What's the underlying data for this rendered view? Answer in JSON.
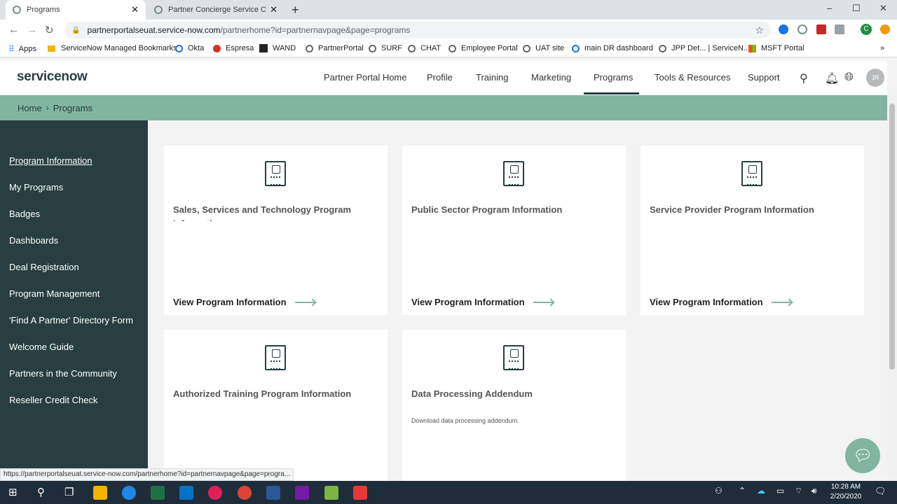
{
  "browser": {
    "tabs": [
      {
        "title": "Programs",
        "active": true
      },
      {
        "title": "Partner Concierge Service Center",
        "active": false
      }
    ],
    "new_tab_icon": "plus-icon",
    "window_controls": {
      "minimize": "–",
      "maximize": "☐",
      "close": "✕"
    },
    "url": "partnerportalseuat.service-now.com/partnerhome?id=partnernavpage&page=programs",
    "url_host": "partnerportalseuat.service-now.com",
    "url_path": "/partnerhome?id=partnernavpage&page=programs",
    "bookmarks": [
      "Apps",
      "ServiceNow Managed Bookmarks",
      "Okta",
      "Espresa",
      "WAND",
      "PartnerPortal",
      "SURF",
      "CHAT",
      "Employee Portal",
      "UAT site",
      "main DR dashboard",
      "JPP Det... | ServiceN...",
      "MSFT Portal"
    ],
    "bookmark_overflow": "»",
    "profile_initial": "C",
    "status_url": "https://partnerportalseuat.service-now.com/partnerhome?id=partnernavpage&page=progra..."
  },
  "header": {
    "logo": "servicenow",
    "nav": [
      "Partner Portal Home",
      "Profile",
      "Training",
      "Marketing",
      "Programs",
      "Tools & Resources",
      "Support"
    ],
    "active_nav": "Programs",
    "avatar_initials": "JR"
  },
  "breadcrumb": {
    "home": "Home",
    "separator": "›",
    "current": "Programs"
  },
  "sidebar": {
    "items": [
      {
        "label": "Program Information",
        "active": true
      },
      {
        "label": "My Programs"
      },
      {
        "label": "Badges"
      },
      {
        "label": "Dashboards"
      },
      {
        "label": "Deal Registration"
      },
      {
        "label": "Program Management"
      },
      {
        "label": "'Find A Partner' Directory Form"
      },
      {
        "label": "Welcome Guide"
      },
      {
        "label": "Partners in the Community"
      },
      {
        "label": "Reseller Credit Check"
      }
    ]
  },
  "cards": [
    {
      "title": "Sales, Services and Technology Program Information",
      "link": "View Program Information",
      "icon": "document-bell-icon"
    },
    {
      "title": "Public Sector Program Information",
      "link": "View Program Information",
      "icon": "document-building-icon"
    },
    {
      "title": "Service Provider Program Information",
      "link": "View Program Information",
      "icon": "document-checkbox-icon"
    },
    {
      "title": "Authorized Training Program Information",
      "icon": "document-presentation-icon"
    },
    {
      "title": "Data Processing Addendum",
      "description": "Download data processing addendum.",
      "icon": "document-refresh-icon"
    }
  ],
  "taskbar": {
    "time": "10:28 AM",
    "date": "2/20/2020"
  },
  "colors": {
    "brand_dark": "#293e40",
    "brand_green": "#81b5a1",
    "background": "#f3f3f3"
  }
}
